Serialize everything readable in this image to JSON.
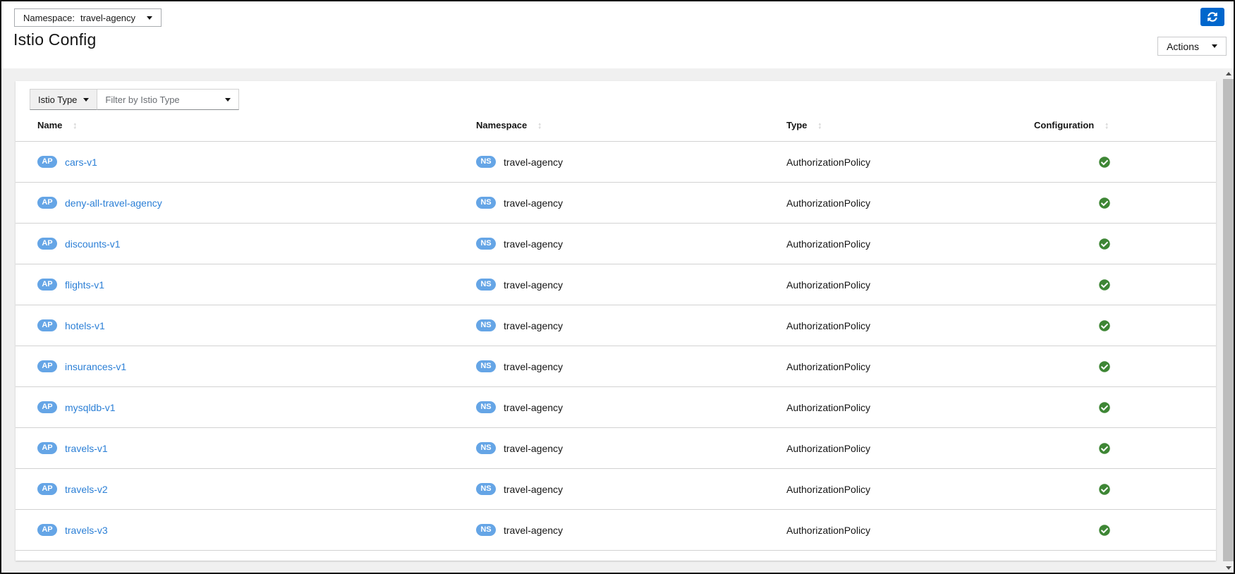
{
  "header": {
    "namespace_selector": {
      "label": "Namespace:",
      "value": "travel-agency"
    },
    "title": "Istio Config",
    "actions_button": "Actions"
  },
  "toolbar": {
    "type_dropdown_label": "Istio Type",
    "filter_placeholder": "Filter by Istio Type"
  },
  "table": {
    "headers": [
      {
        "label": "Name"
      },
      {
        "label": "Namespace"
      },
      {
        "label": "Type"
      },
      {
        "label": "Configuration"
      }
    ],
    "rows": [
      {
        "type_badge": "AP",
        "name": "cars-v1",
        "ns_badge": "NS",
        "namespace": "travel-agency",
        "type": "AuthorizationPolicy",
        "config_status": "valid"
      },
      {
        "type_badge": "AP",
        "name": "deny-all-travel-agency",
        "ns_badge": "NS",
        "namespace": "travel-agency",
        "type": "AuthorizationPolicy",
        "config_status": "valid"
      },
      {
        "type_badge": "AP",
        "name": "discounts-v1",
        "ns_badge": "NS",
        "namespace": "travel-agency",
        "type": "AuthorizationPolicy",
        "config_status": "valid"
      },
      {
        "type_badge": "AP",
        "name": "flights-v1",
        "ns_badge": "NS",
        "namespace": "travel-agency",
        "type": "AuthorizationPolicy",
        "config_status": "valid"
      },
      {
        "type_badge": "AP",
        "name": "hotels-v1",
        "ns_badge": "NS",
        "namespace": "travel-agency",
        "type": "AuthorizationPolicy",
        "config_status": "valid"
      },
      {
        "type_badge": "AP",
        "name": "insurances-v1",
        "ns_badge": "NS",
        "namespace": "travel-agency",
        "type": "AuthorizationPolicy",
        "config_status": "valid"
      },
      {
        "type_badge": "AP",
        "name": "mysqldb-v1",
        "ns_badge": "NS",
        "namespace": "travel-agency",
        "type": "AuthorizationPolicy",
        "config_status": "valid"
      },
      {
        "type_badge": "AP",
        "name": "travels-v1",
        "ns_badge": "NS",
        "namespace": "travel-agency",
        "type": "AuthorizationPolicy",
        "config_status": "valid"
      },
      {
        "type_badge": "AP",
        "name": "travels-v2",
        "ns_badge": "NS",
        "namespace": "travel-agency",
        "type": "AuthorizationPolicy",
        "config_status": "valid"
      },
      {
        "type_badge": "AP",
        "name": "travels-v3",
        "ns_badge": "NS",
        "namespace": "travel-agency",
        "type": "AuthorizationPolicy",
        "config_status": "valid"
      }
    ]
  },
  "icons": {
    "refresh": "sync-icon",
    "sort": "sort-both-icon",
    "sort_glyph": "↕",
    "valid": "check-circle-icon",
    "caret": "caret-down-icon"
  },
  "colors": {
    "brand": "#0066cc",
    "badge": "#65a5e6",
    "link": "#2b7fd6",
    "valid": "#3e8635",
    "page_bg": "#f0f0f0",
    "border": "#d2d2d2"
  }
}
